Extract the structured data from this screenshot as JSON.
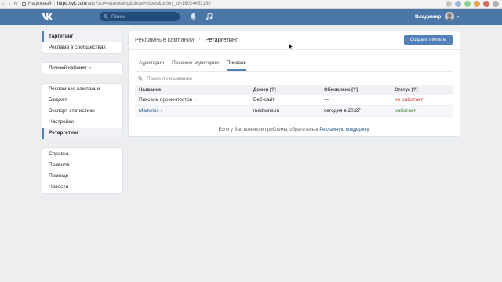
{
  "browser": {
    "secure_label": "Надежный",
    "url_host": "https://vk.com",
    "url_rest": "/ads?act=retargeting&show=pixels&union_id=1602445316#"
  },
  "header": {
    "search_placeholder": "Поиск",
    "user_name": "Владимир",
    "brand_color": "#4a76a8"
  },
  "sidebar": {
    "group1": [
      {
        "label": "Таргетинг",
        "active": true
      },
      {
        "label": "Реклама в сообществах"
      }
    ],
    "cabinet_label": "Личный кабинет",
    "group3": [
      {
        "label": "Рекламные кампании"
      },
      {
        "label": "Бюджет"
      },
      {
        "label": "Экспорт статистики"
      },
      {
        "label": "Настройки"
      },
      {
        "label": "Ретаргетинг",
        "active": true
      }
    ],
    "group4": [
      {
        "label": "Справка"
      },
      {
        "label": "Правила"
      },
      {
        "label": "Помощь"
      },
      {
        "label": "Новости"
      }
    ]
  },
  "main": {
    "breadcrumb_parent": "Рекламные кампании",
    "breadcrumb_current": "Ретаргетинг",
    "create_button": "Создать пиксель",
    "tabs": [
      {
        "label": "Аудитории"
      },
      {
        "label": "Похожие аудитории"
      },
      {
        "label": "Пиксели",
        "active": true
      }
    ],
    "search_placeholder": "Поиск по названию",
    "columns": [
      "Название",
      "Домен [?]",
      "Обновлено [?]",
      "Статус [?]"
    ],
    "rows": [
      {
        "name": "Пиксель промо-постов",
        "domain": "Веб-сайт",
        "updated": "—",
        "status": "не работает",
        "status_kind": "bad"
      },
      {
        "name": "Madwins",
        "domain": "madwins.ru",
        "updated": "сегодня в 20:27",
        "status": "работает",
        "status_kind": "good"
      }
    ]
  },
  "footer": {
    "text": "Если у Вас возникли проблемы, обратитесь в",
    "link": "Рекламную поддержку",
    "end": "."
  }
}
